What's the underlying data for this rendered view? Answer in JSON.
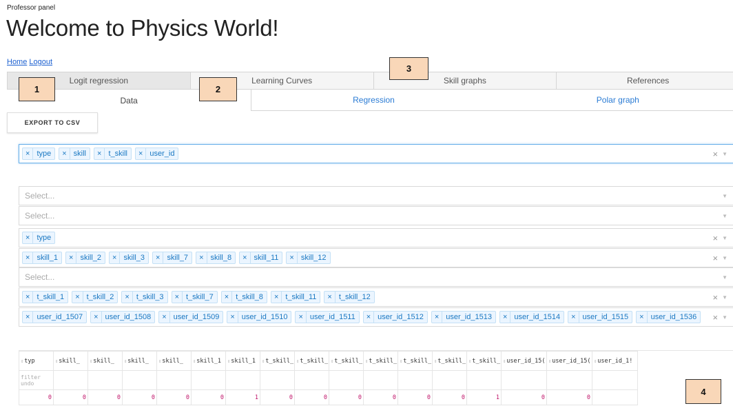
{
  "header": {
    "eyebrow": "Professor panel",
    "title": "Welcome to Physics World!"
  },
  "nav": {
    "home": "Home",
    "logout": "Logout"
  },
  "tabs": [
    "Logit regression",
    "Learning Curves",
    "Skill graphs",
    "References"
  ],
  "subtabs": [
    "Data",
    "Regression",
    "Polar graph"
  ],
  "export_label": "EXPORT TO CSV",
  "selects": [
    {
      "chips": [
        "type",
        "skill",
        "t_skill",
        "user_id"
      ],
      "placeholder": ""
    },
    {
      "chips": [],
      "placeholder": "Select..."
    },
    {
      "chips": [],
      "placeholder": "Select..."
    },
    {
      "chips": [
        "type"
      ],
      "placeholder": ""
    },
    {
      "chips": [
        "skill_1",
        "skill_2",
        "skill_3",
        "skill_7",
        "skill_8",
        "skill_11",
        "skill_12"
      ],
      "placeholder": ""
    },
    {
      "chips": [],
      "placeholder": "Select..."
    },
    {
      "chips": [
        "t_skill_1",
        "t_skill_2",
        "t_skill_3",
        "t_skill_7",
        "t_skill_8",
        "t_skill_11",
        "t_skill_12"
      ],
      "placeholder": ""
    },
    {
      "chips": [
        "user_id_1507",
        "user_id_1508",
        "user_id_1509",
        "user_id_1510",
        "user_id_1511",
        "user_id_1512",
        "user_id_1513",
        "user_id_1514",
        "user_id_1515",
        "user_id_1536"
      ],
      "placeholder": ""
    }
  ],
  "grid": {
    "columns": [
      "typ",
      "skill_",
      "skill_",
      "skill_",
      "skill_",
      "skill_1",
      "skill_1",
      "t_skill_",
      "t_skill_",
      "t_skill_",
      "t_skill_",
      "t_skill_",
      "t_skill_1",
      "t_skill_1",
      "user_id_15(",
      "user_id_15(",
      "user_id_1!"
    ],
    "filter_labels": [
      "filter",
      "undo"
    ],
    "row": [
      "0",
      "0",
      "0",
      "0",
      "0",
      "0",
      "1",
      "0",
      "0",
      "0",
      "0",
      "0",
      "0",
      "1",
      "0",
      "0",
      ""
    ]
  },
  "badges": [
    "1",
    "2",
    "3",
    "4"
  ]
}
